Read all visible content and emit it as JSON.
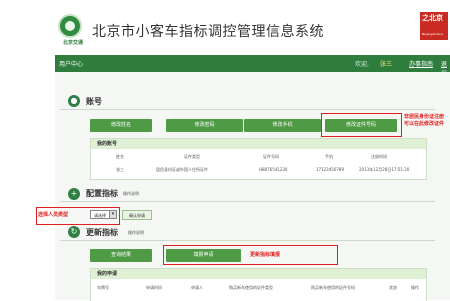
{
  "header": {
    "logo_text": "北京交通",
    "title": "北京市小客车指标调控管理信息系统",
    "seal_text": "之北京",
    "seal_subtext": "Beijing&China"
  },
  "navbar": {
    "user_center": "用户中心",
    "welcome": "欢迎,",
    "user_name": "张三",
    "guide": "办事指南",
    "logout": "退出登录"
  },
  "account": {
    "title": "账号",
    "buttons": [
      "修改姓名",
      "修改密码",
      "修改手机",
      "修改证件号码"
    ],
    "note": [
      "非居民身份证注册",
      "可以在此修改证件"
    ],
    "table_title": "我的账号",
    "columns": [
      "姓名",
      "证件类型",
      "证件号码",
      "手机",
      "注册时间"
    ],
    "row": [
      "张三",
      "居民身份证或外国人住所证件",
      "H8876541230",
      "17123456789",
      "2013年12月28日17:51:20"
    ]
  },
  "config": {
    "title": "配置指标",
    "subtitle": "操作说明",
    "person_type_label": "选择人员类型",
    "select_value": "请选择",
    "select_arrow": "▾",
    "confirm": "确认申请"
  },
  "update": {
    "title": "更新指标",
    "subtitle": "操作说明",
    "buttons": [
      "查询结果",
      "填报申请"
    ],
    "note": "更新指标填报",
    "table_title": "我的申请",
    "columns": [
      "车牌号",
      "申请时间",
      "申请人",
      "购买新车使用的证件类型",
      "购买新车使用的证件号码",
      "状态",
      "操作"
    ]
  },
  "colors": {
    "brand_green": "#2e7d3c",
    "button_green": "#4f9a45",
    "highlight_red": "#e02020"
  }
}
